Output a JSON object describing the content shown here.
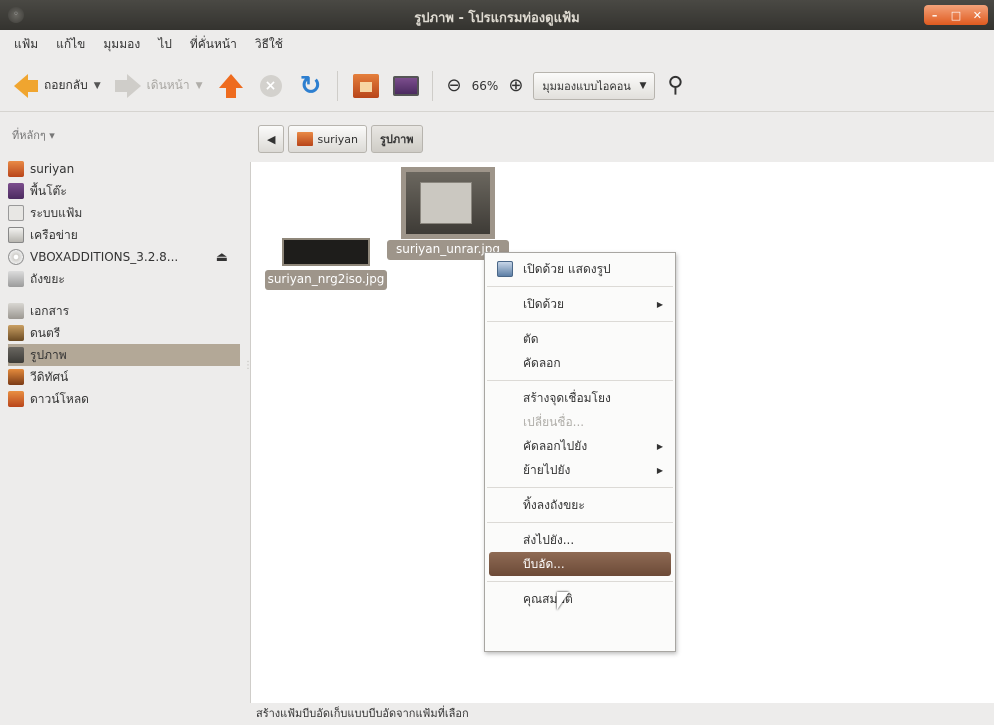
{
  "window": {
    "title": "รูปภาพ - โปรแกรมท่องดูแฟ้ม"
  },
  "menubar": {
    "items": [
      "แฟ้ม",
      "แก้ไข",
      "มุมมอง",
      "ไป",
      "ที่คั่นหน้า",
      "วิธีใช้"
    ]
  },
  "toolbar": {
    "back_label": "ถอยกลับ",
    "forward_label": "เดินหน้า",
    "zoom_value": "66%",
    "view_mode": "มุมมองแบบไอคอน"
  },
  "sidebar": {
    "heading": "ที่หลักๆ",
    "items": [
      {
        "label": "suriyan",
        "icon": "home-folder-icon"
      },
      {
        "label": "พื้นโต๊ะ",
        "icon": "desktop-icon"
      },
      {
        "label": "ระบบแฟ้ม",
        "icon": "filesystem-icon"
      },
      {
        "label": "เครือข่าย",
        "icon": "network-icon"
      },
      {
        "label": "VBOXADDITIONS_3.2.8...",
        "icon": "cd-icon"
      },
      {
        "label": "ถังขยะ",
        "icon": "trash-icon"
      },
      {
        "label": "เอกสาร",
        "icon": "documents-folder-icon"
      },
      {
        "label": "ดนตรี",
        "icon": "music-folder-icon"
      },
      {
        "label": "รูปภาพ",
        "icon": "pictures-folder-icon"
      },
      {
        "label": "วีดิทัศน์",
        "icon": "videos-folder-icon"
      },
      {
        "label": "ดาวน์โหลด",
        "icon": "downloads-folder-icon"
      }
    ]
  },
  "location": {
    "parent": "suriyan",
    "current": "รูปภาพ"
  },
  "files": [
    {
      "name": "suriyan_nrg2iso.jpg"
    },
    {
      "name": "suriyan_unrar.jpg"
    }
  ],
  "context_menu": {
    "items": [
      {
        "label": "เปิดด้วย แสดงรูป"
      },
      {
        "label": "เปิดด้วย"
      },
      {
        "label": "ตัด"
      },
      {
        "label": "คัดลอก"
      },
      {
        "label": "สร้างจุดเชื่อมโยง"
      },
      {
        "label": "เปลี่ยนชื่อ..."
      },
      {
        "label": "คัดลอกไปยัง"
      },
      {
        "label": "ย้ายไปยัง"
      },
      {
        "label": "ทิ้งลงถังขยะ"
      },
      {
        "label": "ส่งไปยัง..."
      },
      {
        "label": "บีบอัด..."
      },
      {
        "label": "คุณสมบัติ"
      }
    ]
  },
  "statusbar": {
    "text": "สร้างแฟ้มบีบอัดเก็บแบบบีบอัดจากแฟ้มที่เลือก"
  },
  "colors": {
    "selection": "#9e958a",
    "menu_highlight": "#7a5641",
    "titlebar": "#3c3b37"
  }
}
